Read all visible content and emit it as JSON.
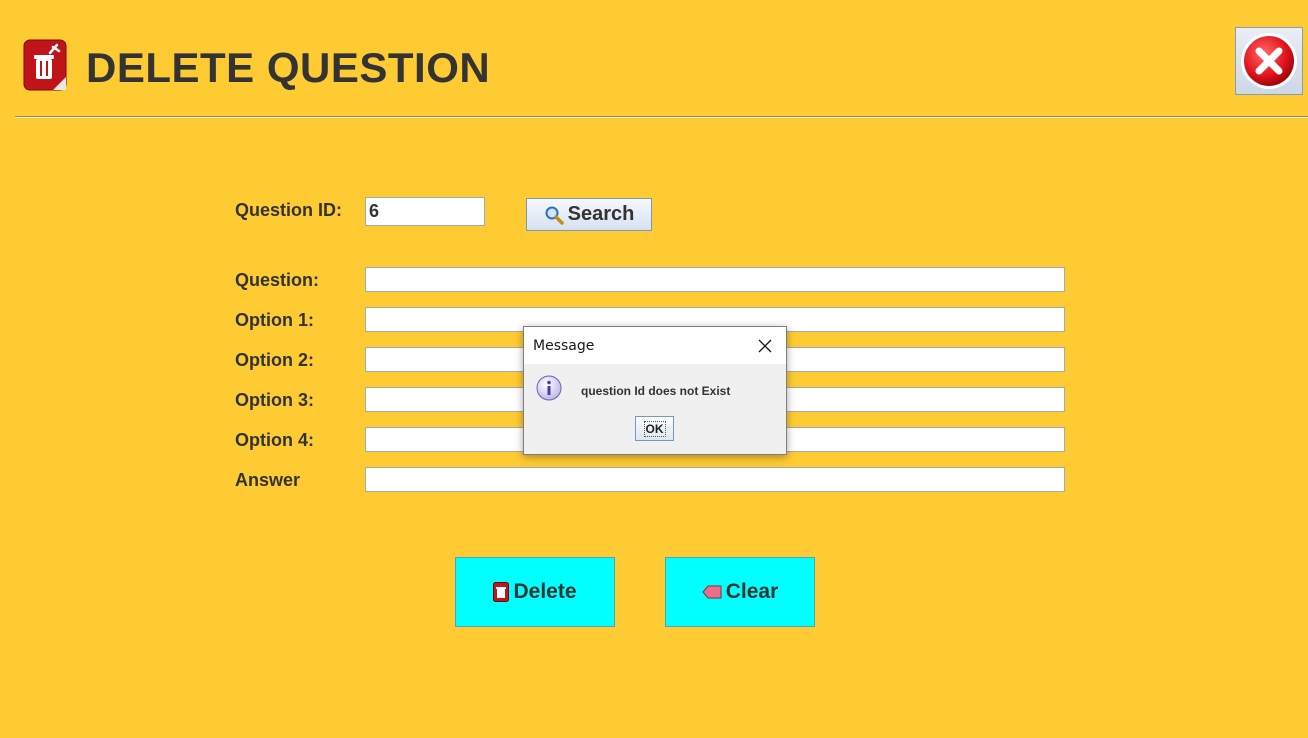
{
  "header": {
    "title": "DELETE QUESTION",
    "app_icon": "trash-icon",
    "close_icon": "close-x-icon"
  },
  "form": {
    "question_id_label": "Question ID:",
    "question_id_value": "6",
    "search_label": "Search",
    "question_label": "Question:",
    "question_value": "",
    "option1_label": "Option 1:",
    "option1_value": "",
    "option2_label": "Option 2:",
    "option2_value": "",
    "option3_label": "Option 3:",
    "option3_value": "",
    "option4_label": "Option 4:",
    "option4_value": "",
    "answer_label": "Answer",
    "answer_value": ""
  },
  "actions": {
    "delete_label": "Delete",
    "clear_label": "Clear"
  },
  "dialog": {
    "title": "Message",
    "message": "question Id does not Exist",
    "ok_label": "OK",
    "icon": "info-icon"
  },
  "colors": {
    "background": "#FFCB33",
    "action_button": "#00FFFF",
    "text": "#333333"
  }
}
